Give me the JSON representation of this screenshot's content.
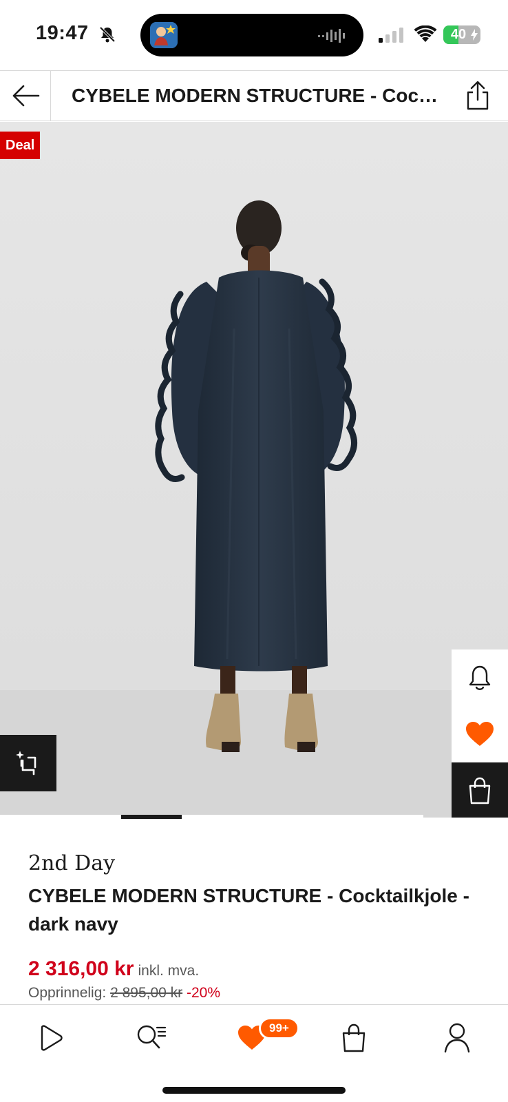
{
  "status_bar": {
    "time": "19:47",
    "battery_level": "40",
    "battery_fraction": 0.4,
    "icons": [
      "bell-muted-icon",
      "dynamic-island-app-icon",
      "audio-wave-icon",
      "cellular-signal-icon",
      "wifi-icon",
      "battery-charging-icon"
    ]
  },
  "header": {
    "title": "CYBELE MODERN STRUCTURE - Cocktailkjole - dark navy",
    "back_icon": "arrow-left-icon",
    "share_icon": "share-icon"
  },
  "gallery": {
    "deal_badge": "Deal",
    "active_slide_fraction": 0.143,
    "crop_icon": "sparkle-crop-icon",
    "side_actions": [
      "bell-icon",
      "heart-icon",
      "shopping-bag-icon"
    ]
  },
  "product": {
    "brand": "2nd Day",
    "name": "CYBELE MODERN STRUCTURE - Cocktailkjole - dark navy",
    "price": "2 316,00 kr",
    "vat_note": "inkl. mva.",
    "original_label": "Opprinnelig:",
    "original_price": "2 895,00 kr",
    "discount": "-20%"
  },
  "bottom_nav": {
    "items": [
      "play-icon",
      "search-list-icon",
      "heart-icon",
      "shopping-bag-icon",
      "profile-icon"
    ],
    "wishlist_badge": "99+"
  },
  "colors": {
    "accent_orange": "#ff5a00",
    "price_red": "#d0021b",
    "deal_red": "#d50000",
    "dark": "#1a1a1a",
    "backdrop": "#e4e4e4"
  }
}
